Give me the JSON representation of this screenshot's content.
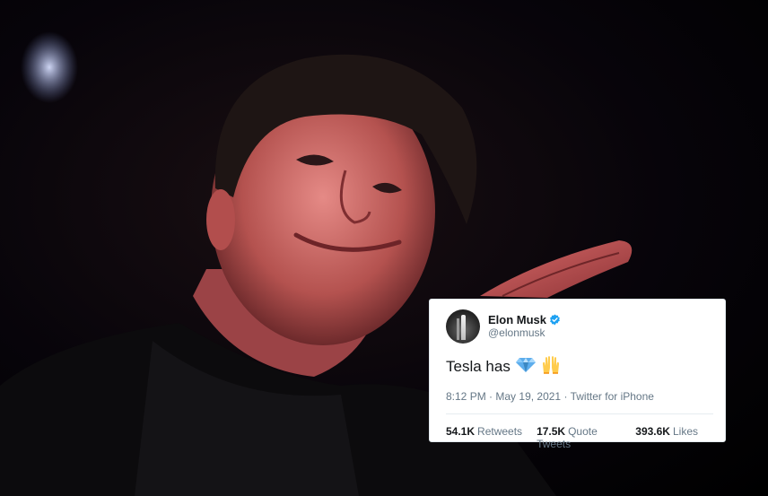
{
  "tweet": {
    "display_name": "Elon Musk",
    "handle": "@elonmusk",
    "text": "Tesla has",
    "emojis": [
      "gem-stone-icon",
      "raising-hands-icon"
    ],
    "time": "8:12 PM",
    "date": "May 19, 2021",
    "source": "Twitter for iPhone",
    "stats": {
      "retweets_count": "54.1K",
      "retweets_label": "Retweets",
      "quote_tweets_count": "17.5K",
      "quote_tweets_label": "Quote Tweets",
      "likes_count": "393.6K",
      "likes_label": "Likes"
    }
  },
  "colors": {
    "verified_badge": "#1da1f2",
    "secondary_text": "#657786",
    "primary_text": "#14171a",
    "background_photo": "#000000"
  }
}
